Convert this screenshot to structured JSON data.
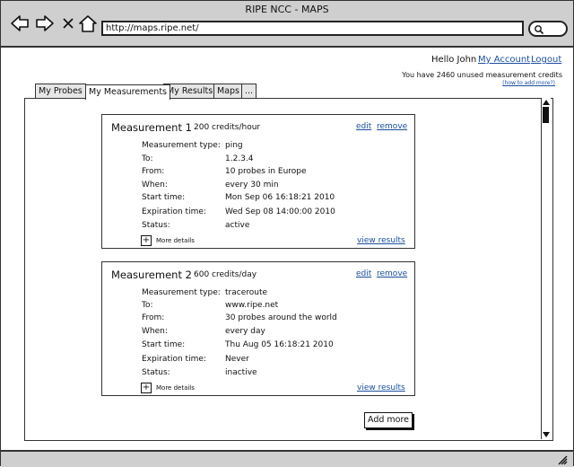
{
  "window": {
    "title": "RIPE NCC - MAPS"
  },
  "browser": {
    "url": "http://maps.ripe.net/"
  },
  "user": {
    "greeting": "Hello John",
    "account_link": "My Account",
    "logout_link": "Logout",
    "credits_text": "You have 2460 unused measurement credits",
    "howto_link": "(how to add more?)"
  },
  "tabs": [
    {
      "label": "My Probes"
    },
    {
      "label": "My Measurements"
    },
    {
      "label": "My Results"
    },
    {
      "label": "Maps"
    },
    {
      "label": "..."
    }
  ],
  "field_labels": {
    "type": "Measurement type:",
    "to": "To:",
    "from": "From:",
    "when": "When:",
    "start": "Start time:",
    "expiration": "Expiration time:",
    "status": "Status:"
  },
  "card_actions": {
    "edit": "edit",
    "remove": "remove",
    "more_details": "More details",
    "view_results": "view results"
  },
  "measurements": [
    {
      "title": "Measurement 1",
      "rate": "200 credits/hour",
      "type": "ping",
      "to": "1.2.3.4",
      "from": "10 probes in Europe",
      "when": "every 30 min",
      "start": "Mon Sep 06 16:18:21 2010",
      "expiration": "Wed Sep 08 14:00:00 2010",
      "status": "active"
    },
    {
      "title": "Measurement 2",
      "rate": "600 credits/day",
      "type": "traceroute",
      "to": "www.ripe.net",
      "from": "30 probes around the world",
      "when": "every day",
      "start": "Thu Aug 05 16:18:21 2010",
      "expiration": "Never",
      "status": "inactive"
    }
  ],
  "add_more_label": "Add more"
}
